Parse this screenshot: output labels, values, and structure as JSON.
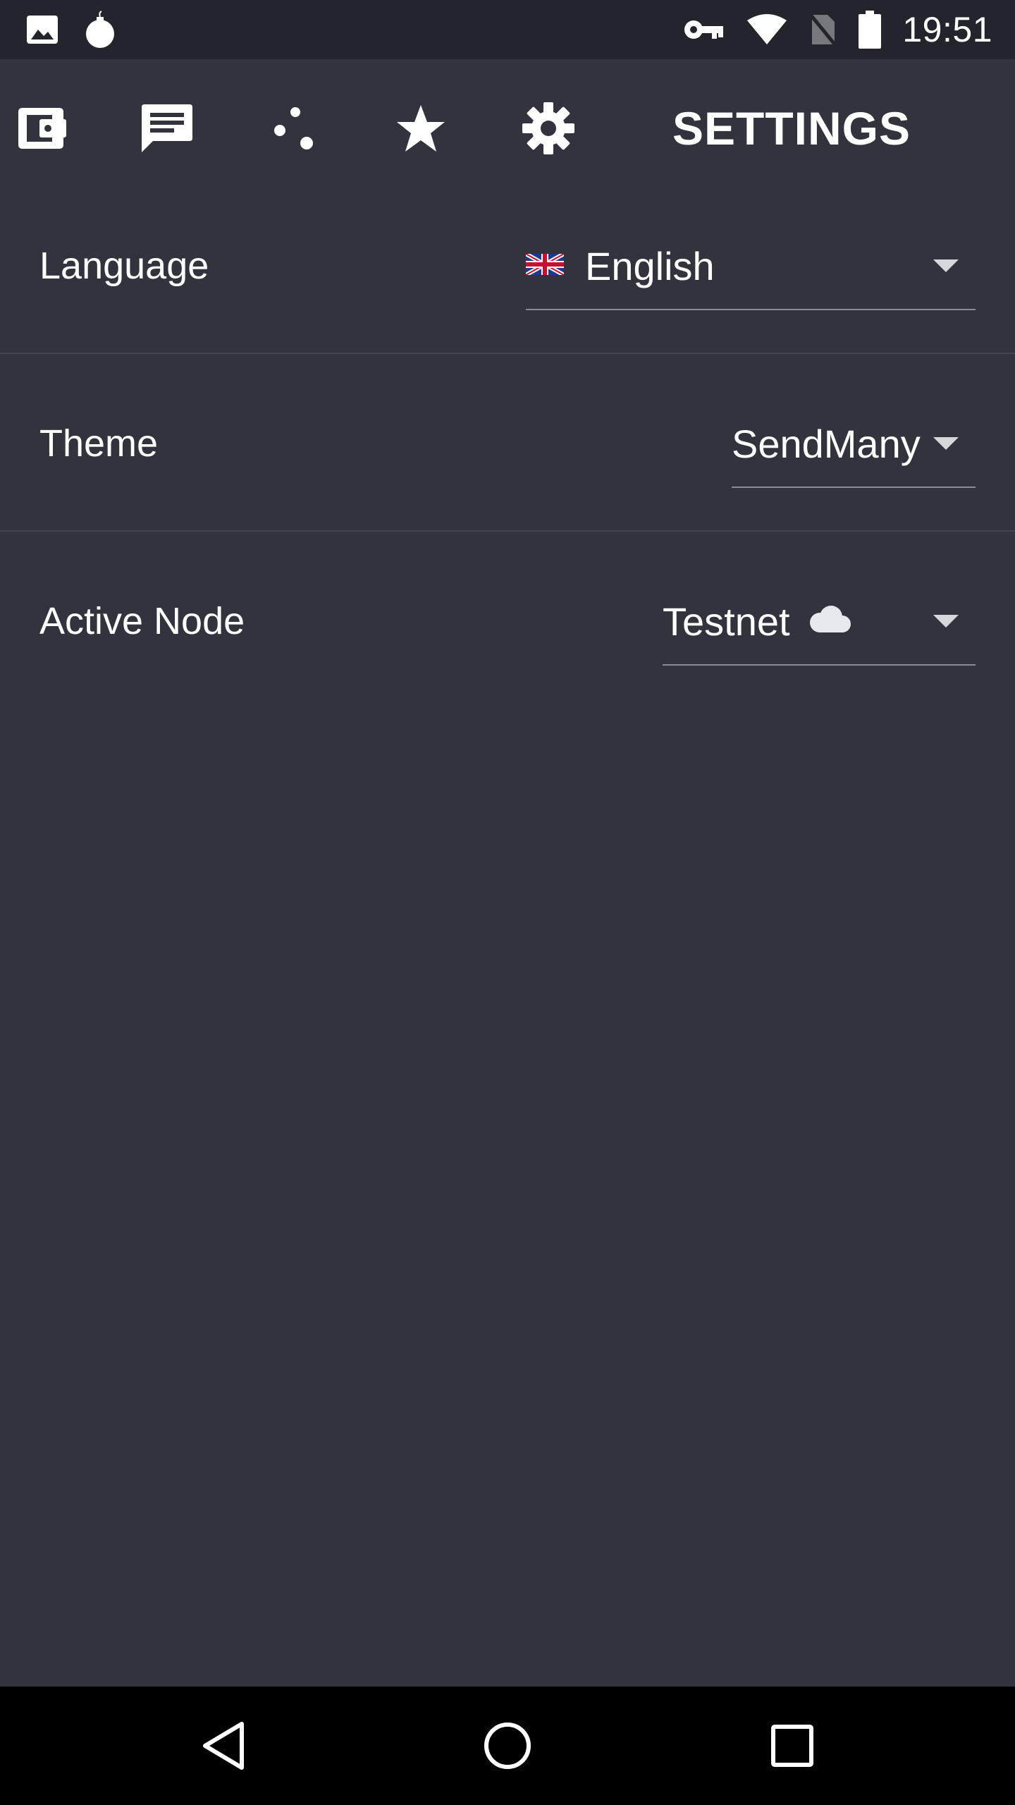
{
  "status_bar": {
    "time": "19:51",
    "left_icons": [
      "image-icon",
      "bomb-icon"
    ],
    "right_icons": [
      "vpn-key-icon",
      "wifi-icon",
      "no-sim-icon",
      "battery-icon"
    ]
  },
  "app_bar": {
    "title": "SETTINGS",
    "nav_icons": [
      "wallet-icon",
      "message-icon",
      "scatter-dots-icon",
      "star-icon",
      "gear-icon"
    ]
  },
  "settings": {
    "language": {
      "label": "Language",
      "value": "English",
      "flag_icon": "uk-flag-icon"
    },
    "theme": {
      "label": "Theme",
      "value": "SendMany"
    },
    "active_node": {
      "label": "Active Node",
      "value": "Testnet",
      "value_icon": "cloud-icon"
    }
  },
  "system_nav": {
    "buttons": [
      "back-icon",
      "home-icon",
      "recents-icon"
    ]
  },
  "colors": {
    "background": "#33333d",
    "status_bar": "#24242c",
    "nav_bar": "#000000",
    "divider": "#44444f",
    "text": "#ffffff"
  }
}
